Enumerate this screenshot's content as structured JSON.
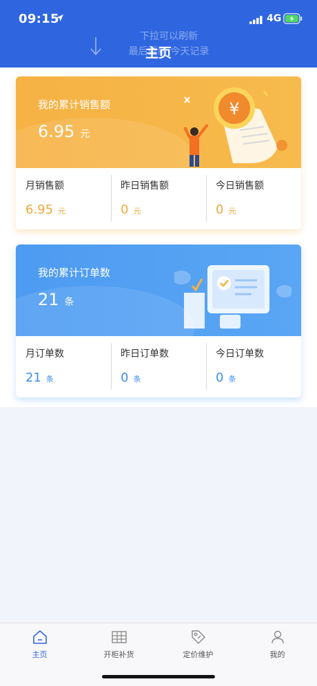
{
  "status_bar": {
    "time": "09:15",
    "network": "4G"
  },
  "pull_refresh": {
    "line1": "下拉可以刷新",
    "line2": "最后更新:今天记录"
  },
  "header": {
    "title": "主页"
  },
  "sales_card": {
    "title": "我的累计销售额",
    "total": "6.95",
    "total_unit": "元",
    "stats": [
      {
        "label": "月销售额",
        "value": "6.95",
        "unit": "元"
      },
      {
        "label": "昨日销售额",
        "value": "0",
        "unit": "元"
      },
      {
        "label": "今日销售额",
        "value": "0",
        "unit": "元"
      }
    ]
  },
  "orders_card": {
    "title": "我的累计订单数",
    "total": "21",
    "total_unit": "条",
    "stats": [
      {
        "label": "月订单数",
        "value": "21",
        "unit": "条"
      },
      {
        "label": "昨日订单数",
        "value": "0",
        "unit": "条"
      },
      {
        "label": "今日订单数",
        "value": "0",
        "unit": "条"
      }
    ]
  },
  "tabbar": {
    "items": [
      {
        "label": "主页",
        "icon": "home-icon",
        "active": true
      },
      {
        "label": "开柜补货",
        "icon": "cabinet-icon",
        "active": false
      },
      {
        "label": "定价维护",
        "icon": "price-tag-icon",
        "active": false
      },
      {
        "label": "我的",
        "icon": "user-icon",
        "active": false
      }
    ]
  },
  "colors": {
    "header": "#2f66e0",
    "sales_accent": "#f0a83a",
    "orders_accent": "#3e8fea",
    "tab_active": "#2f66e0"
  }
}
